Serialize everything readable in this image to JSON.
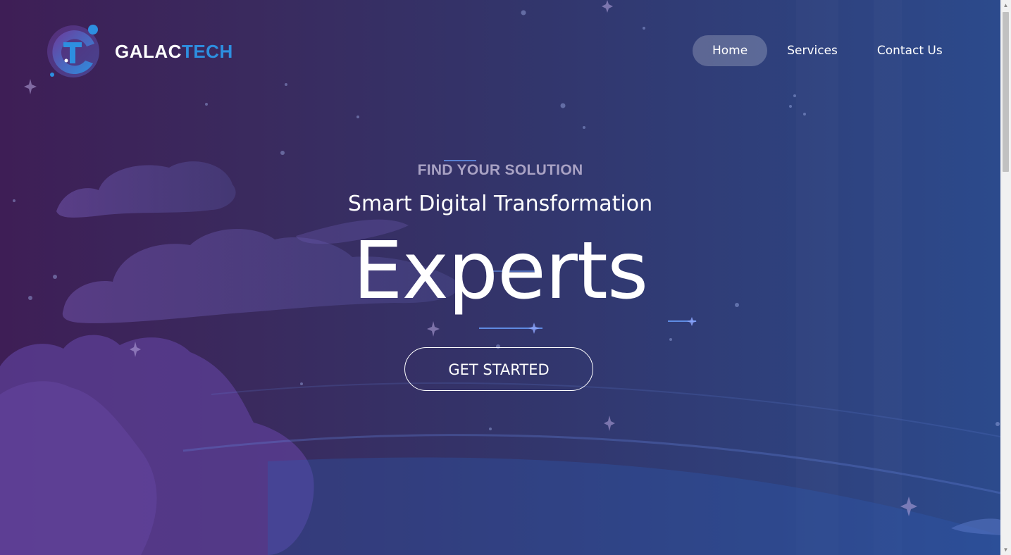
{
  "brand": {
    "name_part1": "GALAC",
    "name_part2": "TECH",
    "accent_color": "#2d8fe0"
  },
  "nav": {
    "items": [
      {
        "label": "Home",
        "active": true
      },
      {
        "label": "Services",
        "active": false
      },
      {
        "label": "Contact Us",
        "active": false
      }
    ]
  },
  "hero": {
    "eyebrow": "FIND YOUR SOLUTION",
    "subtitle": "Smart Digital Transformation",
    "headline": "Experts",
    "cta_label": "GET STARTED"
  },
  "icons": {
    "logo": "galactech-logo-icon",
    "scroll_up": "scroll-up-arrow-icon",
    "scroll_down": "scroll-down-arrow-icon"
  }
}
